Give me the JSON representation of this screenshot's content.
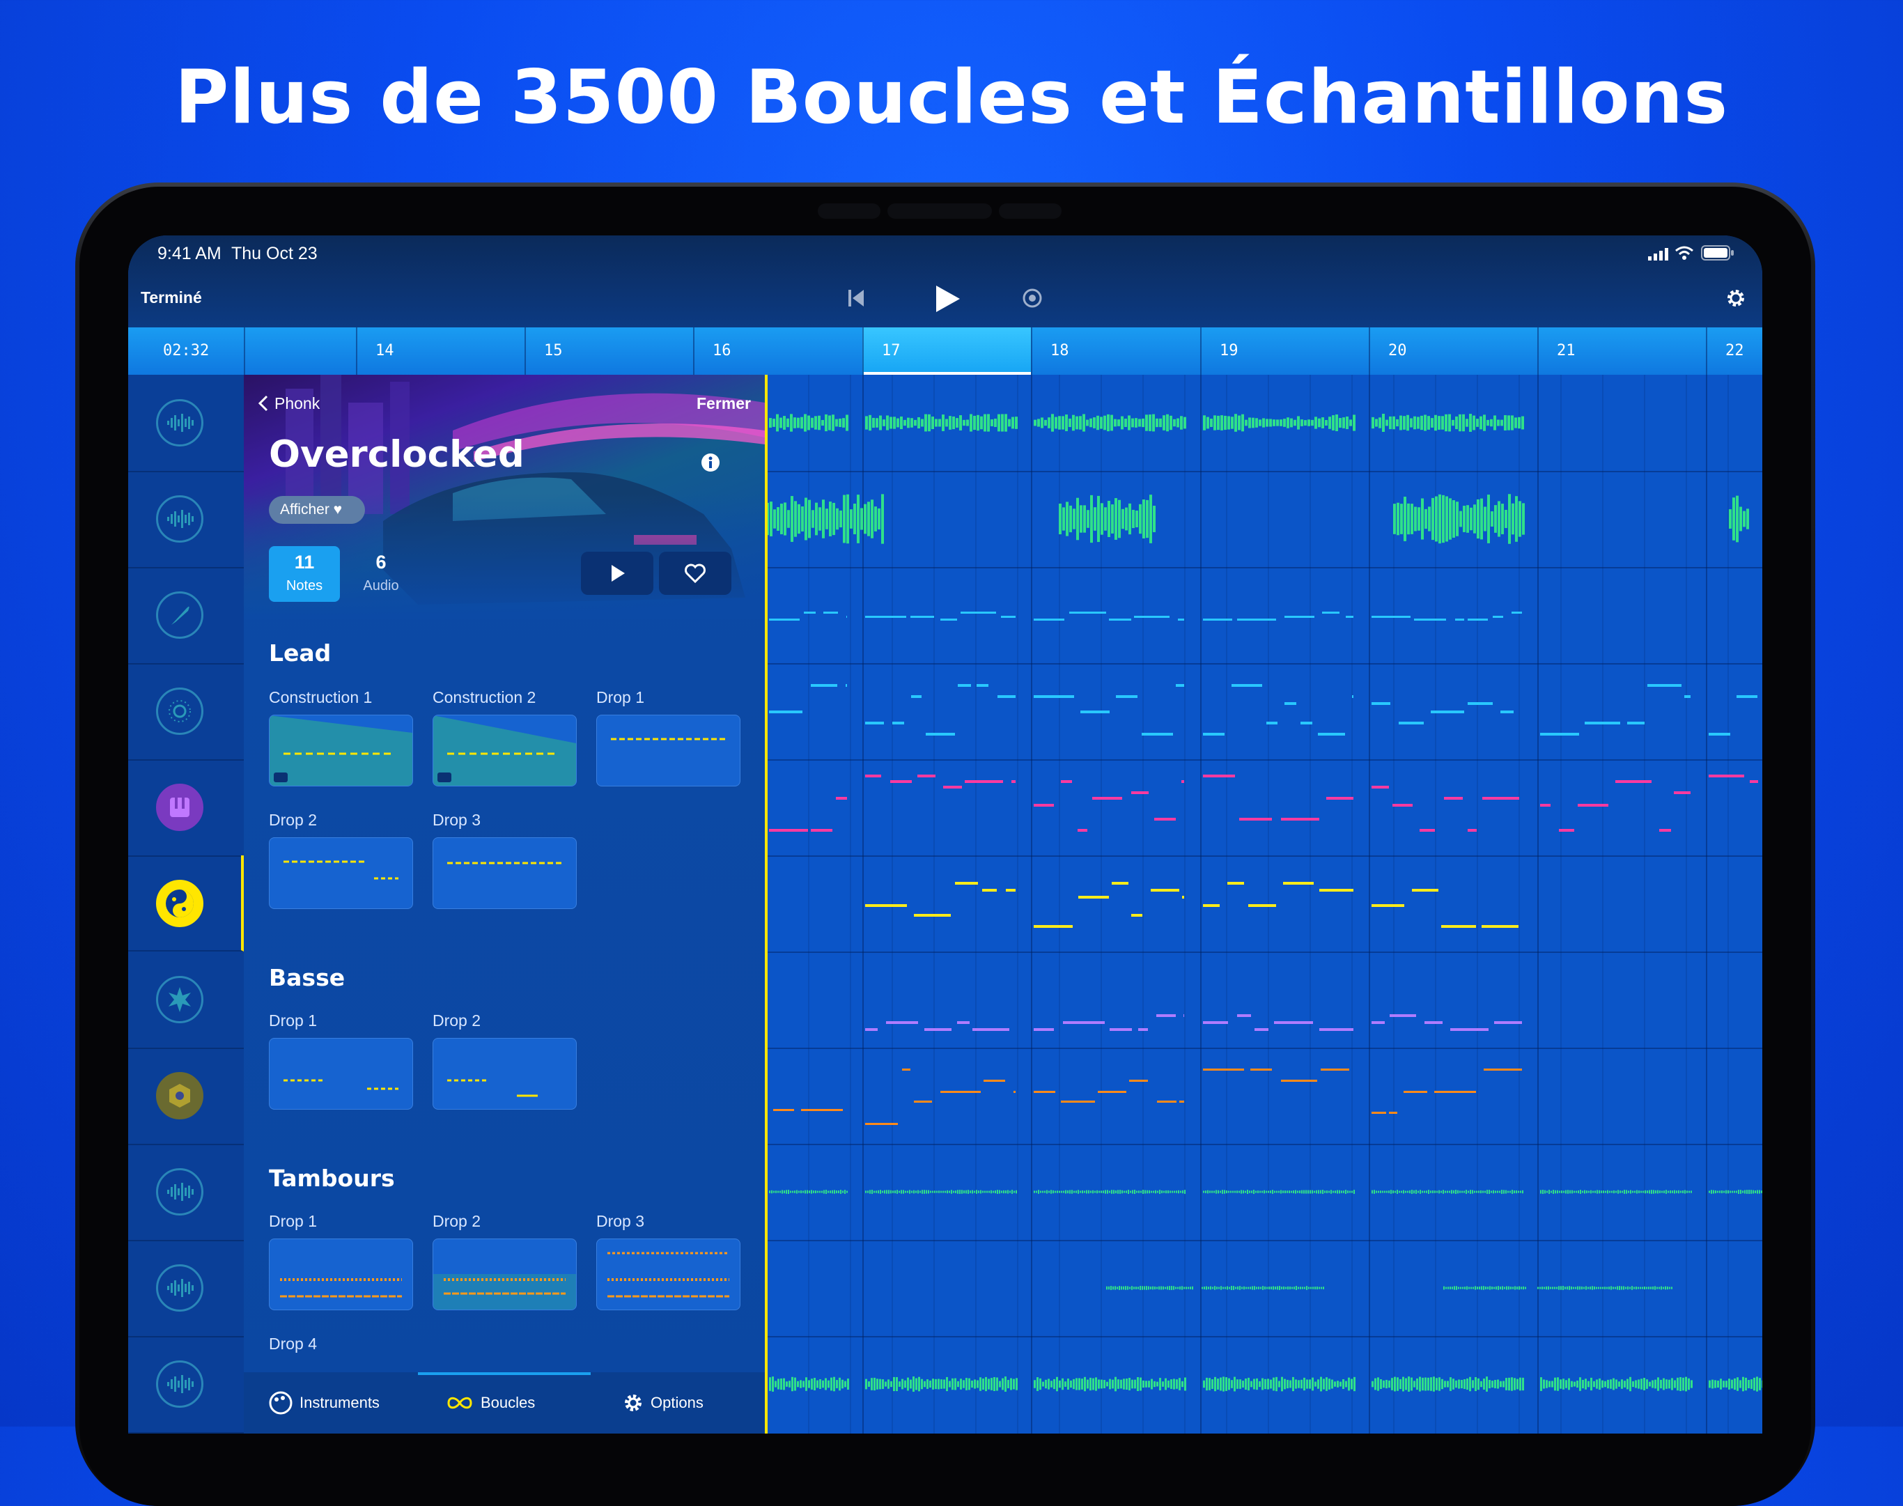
{
  "headline": "Plus de 3500 Boucles et Échantillons",
  "status": {
    "time": "9:41 AM",
    "date": "Thu Oct 23"
  },
  "toolbar": {
    "done": "Terminé"
  },
  "ruler": [
    "02:32",
    "14",
    "15",
    "16",
    "17",
    "18",
    "19",
    "20",
    "21",
    "22"
  ],
  "panel": {
    "back": "Phonk",
    "close": "Fermer",
    "title": "Overclocked",
    "show_button": "Afficher ♥",
    "notes_count": "11",
    "notes_label": "Notes",
    "audio_count": "6",
    "audio_label": "Audio",
    "sections": {
      "lead": {
        "title": "Lead",
        "items": [
          "Construction 1",
          "Construction 2",
          "Drop 1",
          "Drop 2",
          "Drop 3"
        ]
      },
      "bass": {
        "title": "Basse",
        "items": [
          "Drop 1",
          "Drop 2"
        ]
      },
      "drums": {
        "title": "Tambours",
        "items": [
          "Drop 1",
          "Drop 2",
          "Drop 3",
          "Drop 4"
        ]
      }
    },
    "tabs": {
      "instruments": "Instruments",
      "loops": "Boucles",
      "options": "Options"
    }
  },
  "colors": {
    "accent": "#ffe600",
    "green": "#2fe08a",
    "cyan": "#29c8ff",
    "pink": "#ff3aa0",
    "yellow": "#ffec1a",
    "purple": "#b07cff",
    "orange": "#ff8a1a"
  },
  "icons": [
    "waveform-icon",
    "waveform-icon",
    "feather-icon",
    "sun-icon",
    "piano-icon",
    "yin-yang-icon",
    "burst-icon",
    "hex-nut-icon",
    "waveform-icon",
    "waveform-icon",
    "waveform-icon"
  ]
}
